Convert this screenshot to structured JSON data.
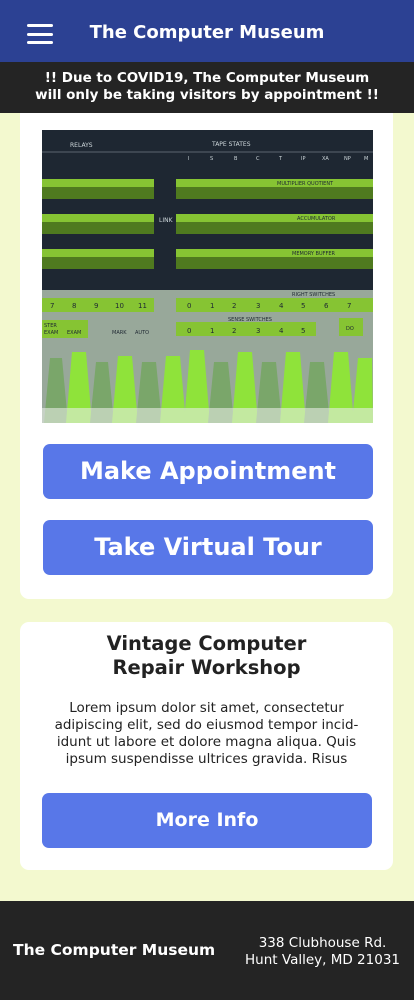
{
  "header": {
    "title": "The Computer Museum",
    "menu_icon": "hamburger-menu-icon"
  },
  "notice": {
    "line1": "!! Due to COVID19, The Computer Museum",
    "line2": "will only be taking visitors by appointment !!"
  },
  "hero": {
    "photo_panel": {
      "relays": "RELAYS",
      "tape_states": "TAPE STATES",
      "tape_labels": [
        "I",
        "S",
        "B",
        "C",
        "T",
        "IP",
        "XA",
        "NP",
        "M"
      ],
      "multiplier": "MULTIPLIER QUOTIENT",
      "link": "LINK",
      "accumulator": "ACCUMULATOR",
      "memory_buffer": "MEMORY BUFFER",
      "right_switches": "RIGHT SWITCHES",
      "sense_switches": "SENSE SWITCHES",
      "left_nums": [
        "7",
        "8",
        "9",
        "10",
        "11"
      ],
      "right_nums": [
        "0",
        "1",
        "2",
        "3",
        "4",
        "5",
        "6",
        "7"
      ],
      "sense_nums": [
        "0",
        "1",
        "2",
        "3",
        "4",
        "5"
      ],
      "ster": "STER",
      "exam": "EXAM",
      "exam2": "EXAM",
      "mark": "MARK",
      "auto": "AUTO",
      "do": "DO"
    },
    "make_appointment": "Make Appointment",
    "virtual_tour": "Take Virtual Tour"
  },
  "workshop": {
    "title_line1": "Vintage Computer",
    "title_line2": "Repair Workshop",
    "body_line1": "Lorem ipsum dolor sit amet, consectetur",
    "body_line2": "adipiscing elit, sed do eiusmod tempor incid-",
    "body_line3": "idunt ut labore et dolore magna aliqua. Quis",
    "body_line4": "ipsum suspendisse ultrices gravida. Risus",
    "more_info": "More Info"
  },
  "footer": {
    "name": "The Computer Museum",
    "address_line1": "338 Clubhouse Rd.",
    "address_line2": "Hunt Valley, MD 21031"
  },
  "colors": {
    "header_bg": "#2c4193",
    "notice_bg": "#242424",
    "page_bg": "#f3f9cf",
    "button_bg": "#5877e8",
    "panel_green": "#86c433"
  }
}
